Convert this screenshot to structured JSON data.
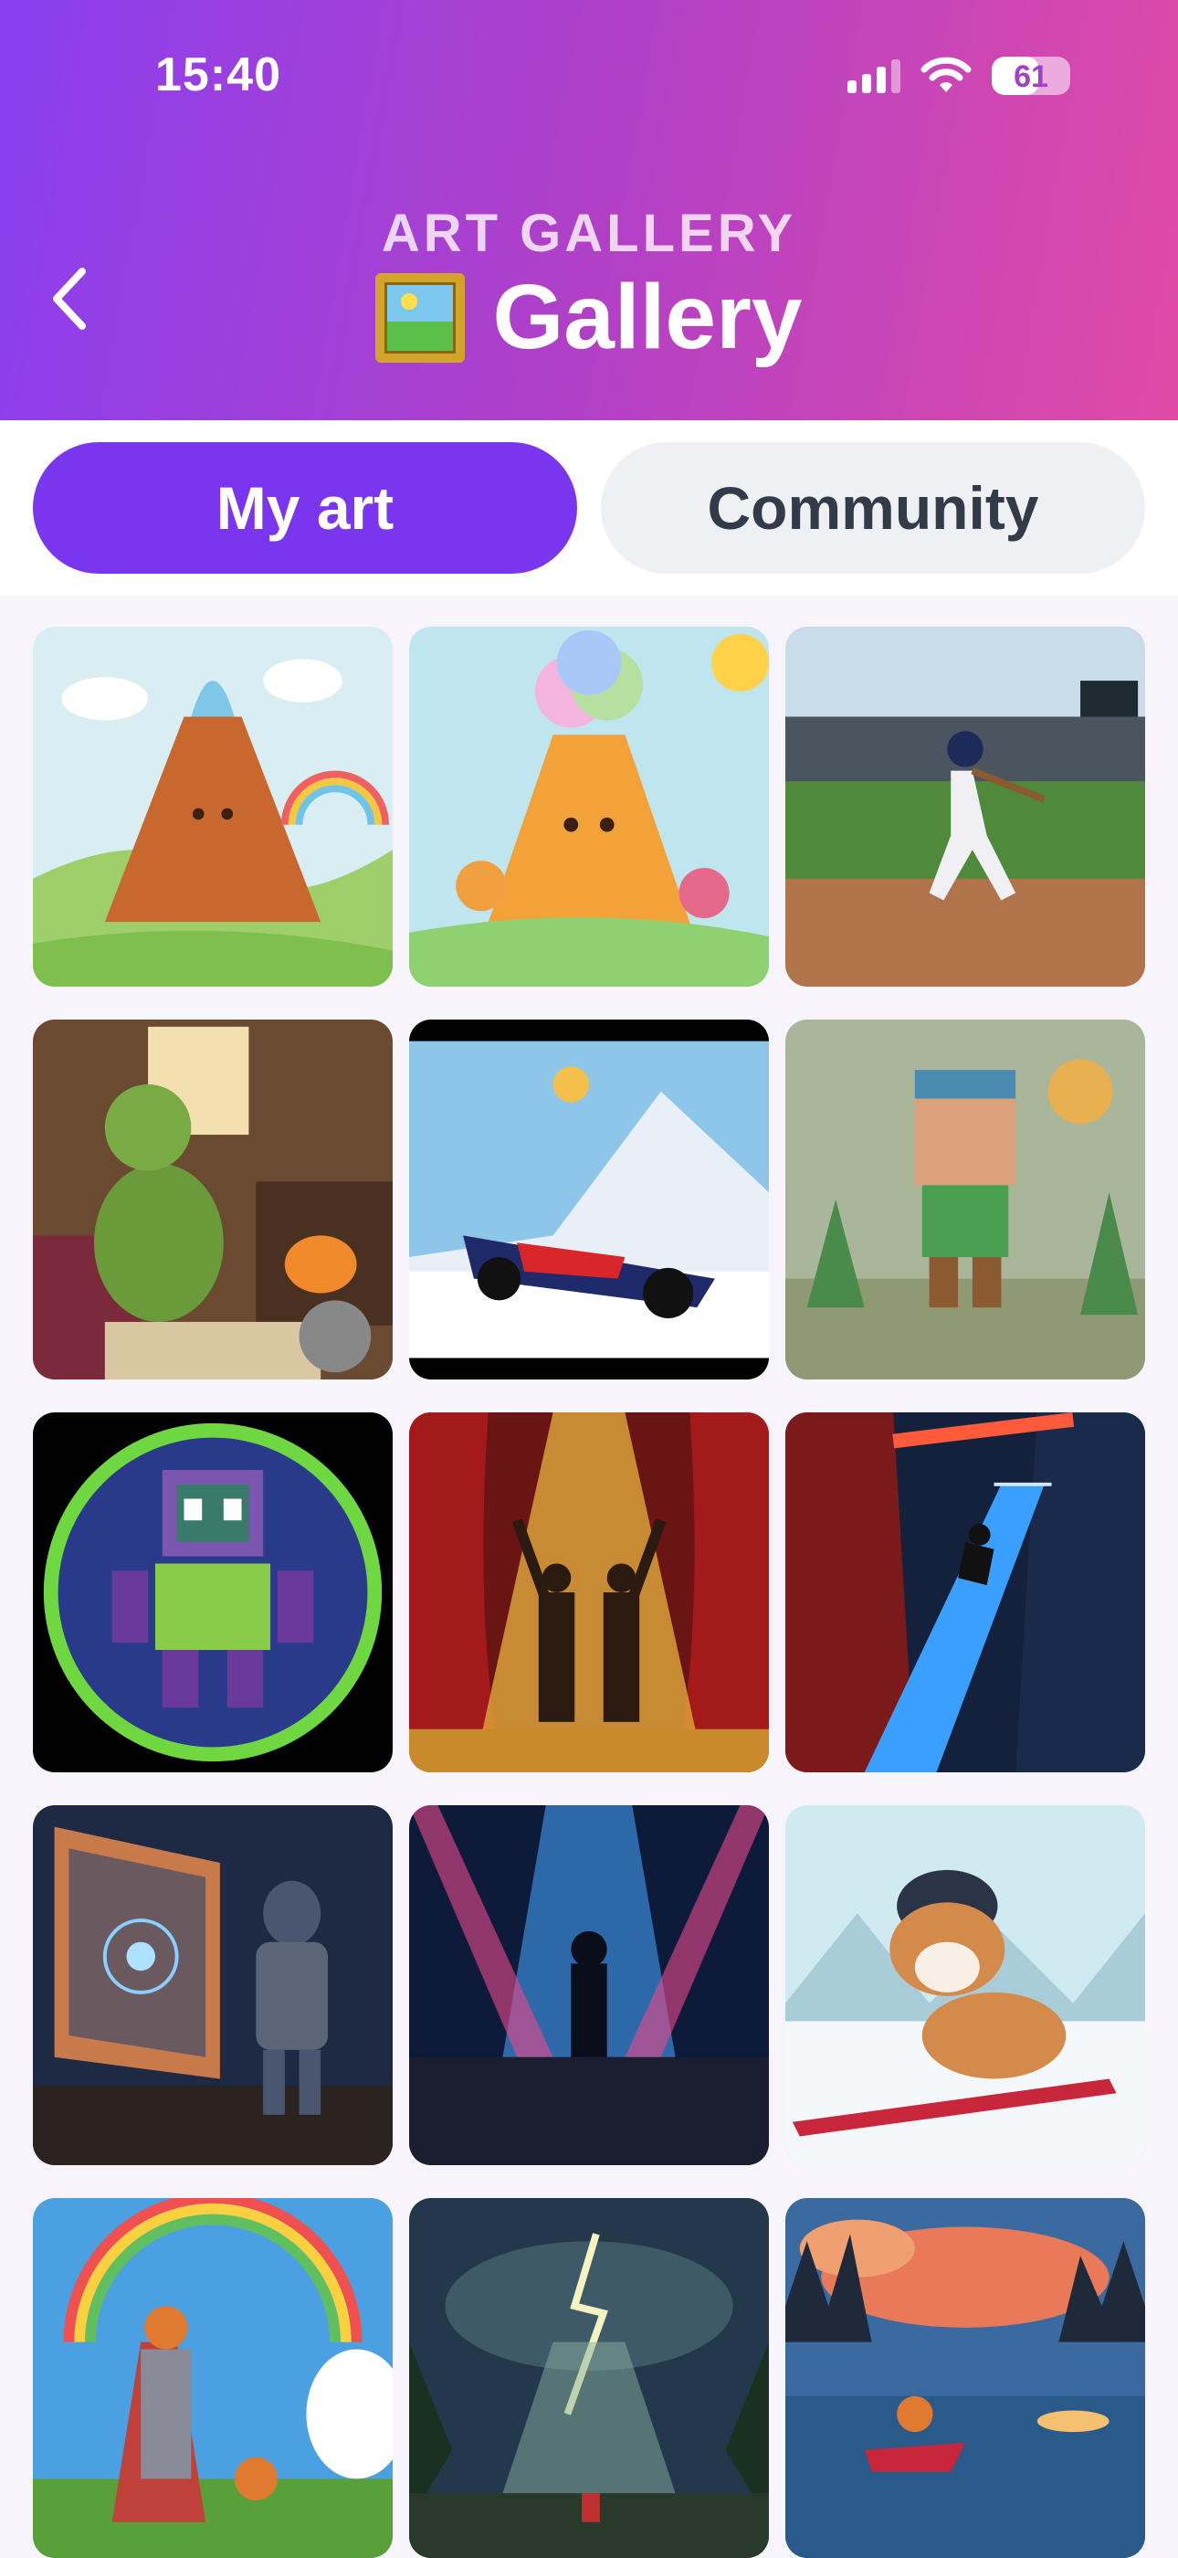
{
  "status_bar": {
    "time": "15:40",
    "battery": "61",
    "battery_level": 0.61
  },
  "header": {
    "eyebrow": "ART GALLERY",
    "title": "Gallery",
    "back_icon": "chevron-left-icon",
    "title_icon": "framed-picture-icon"
  },
  "tabs": [
    {
      "label": "My art",
      "active": true
    },
    {
      "label": "Community",
      "active": false
    }
  ],
  "colors": {
    "accent": "#7a35ee",
    "header_start": "#8a3ff0",
    "header_end": "#e14aa6"
  },
  "gallery": [
    {
      "subject": "cartoon volcano with rainbow"
    },
    {
      "subject": "kawaii rainbow volcano"
    },
    {
      "subject": "baseball batter swinging"
    },
    {
      "subject": "dragon playing chess by fireplace"
    },
    {
      "subject": "Red Bull race car in snow"
    },
    {
      "subject": "papercraft voxel boy"
    },
    {
      "subject": "pixel robot badge"
    },
    {
      "subject": "two figures on stage with confetti"
    },
    {
      "subject": "runner on glowing stairs in canyon"
    },
    {
      "subject": "robot painting star map"
    },
    {
      "subject": "figure on stage under spotlights"
    },
    {
      "subject": "bulldog snowboarding"
    },
    {
      "subject": "fox knight under rainbow"
    },
    {
      "subject": "lightning storm over forest path"
    },
    {
      "subject": "fox riding jet ski at sunset"
    }
  ]
}
